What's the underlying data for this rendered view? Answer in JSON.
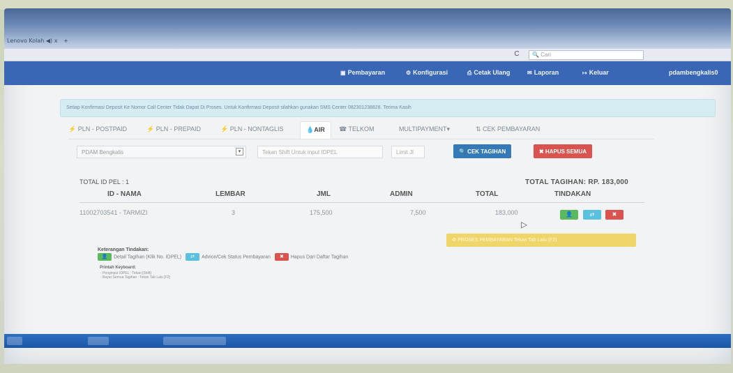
{
  "browser": {
    "tab_label": "Lenovo Kolah",
    "tab_sound": "◀)",
    "tab_close": "x",
    "new_tab": "+",
    "reload": "C",
    "search_placeholder": "Cari"
  },
  "navbar": {
    "items": [
      {
        "icon": "▣",
        "label": "Pembayaran"
      },
      {
        "icon": "⚙",
        "label": "Konfigurasi"
      },
      {
        "icon": "⎙",
        "label": "Cetak Ulang"
      },
      {
        "icon": "✉",
        "label": "Laporan"
      },
      {
        "icon": "↦",
        "label": "Keluar"
      }
    ],
    "user": "pdambengkalis0"
  },
  "alert_text": "Setiap Konfirmasi Deposit Ke Nomor Call Center Tidak Dapat Di Proses. Untuk Konfirmasi Deposit silahkan gunakan SMS Center 082301238828. Terima Kasih",
  "tabs": [
    {
      "label": "⚡ PLN - POSTPAID"
    },
    {
      "label": "⚡ PLN - PREPAID"
    },
    {
      "label": "⚡ PLN - NONTAGLIS"
    },
    {
      "label": "💧AIR"
    },
    {
      "label": "☎ TELKOM"
    },
    {
      "label": "MULTIPAYMENT▾"
    },
    {
      "label": "⇅ CEK PEMBAYARAN"
    }
  ],
  "form": {
    "select_value": "PDAM Bengkalis",
    "idpel_placeholder": "Tekan Shift Untuk input IDPEL",
    "limit_placeholder": "Limit Jl",
    "cek_button": "🔍 CEK TAGIHAN",
    "hapus_button": "✖ HAPUS SEMUA"
  },
  "summary": {
    "total_id": "TOTAL ID PEL : 1",
    "total_tagihan": "TOTAL TAGIHAN: RP. 183,000"
  },
  "table": {
    "headers": [
      "ID - NAMA",
      "LEMBAR",
      "JML",
      "ADMIN",
      "TOTAL",
      "TINDAKAN"
    ],
    "rows": [
      {
        "id_nama": "11002703541 - TARMIZI",
        "lembar": "3",
        "jml": "175,500",
        "admin": "7,500",
        "total": "183,000"
      }
    ]
  },
  "actions": {
    "detail": "👤",
    "advice": "⇄",
    "hapus": "✖"
  },
  "proses_button": "♻ PROSES PEMBAYARAN Tekan Tab Lalu (F2)",
  "keterangan": {
    "title": "Keterangan Tindakan:",
    "detail": "Detail Tagihan (Klik No. IDPEL)",
    "advice": "Advice/Cek Status Pembayaran",
    "hapus": "Hapus Dari Daftar Tagihan"
  },
  "keyboard": {
    "title": "Printah Keyboard:",
    "line1": "- Penginput IDPEL : Tekan [Shift]",
    "line2": "- Bayar Semua Tagihan : Tekan Tab Lalu [F2]"
  },
  "colors": {
    "navbar": "#3a67b5",
    "primary": "#337ab7",
    "danger": "#d9534f",
    "success": "#5cb85c",
    "info": "#5bc0de",
    "warning": "#f0d66a"
  }
}
